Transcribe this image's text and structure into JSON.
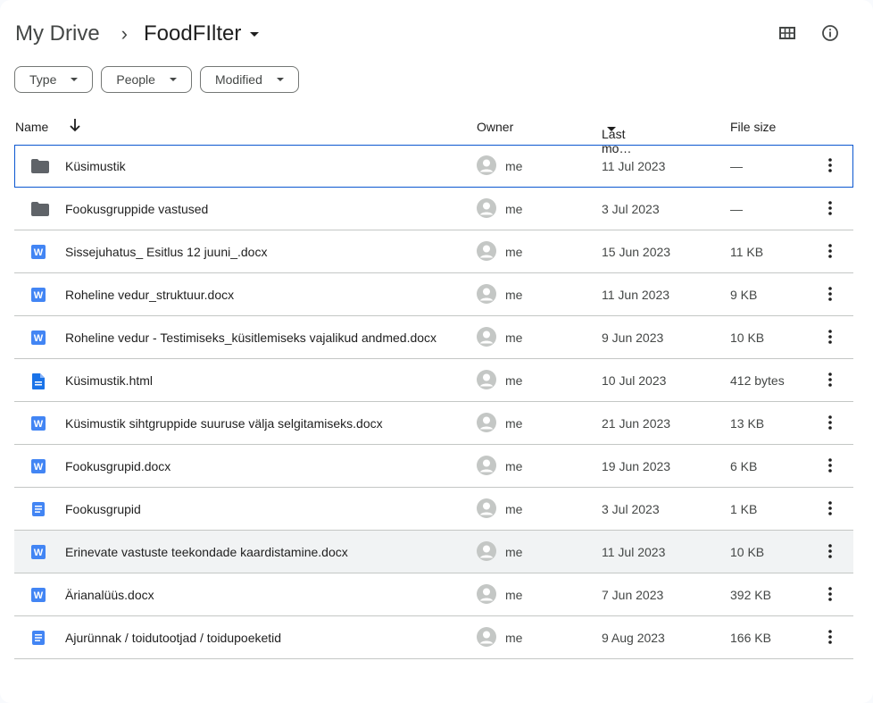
{
  "breadcrumb": {
    "root": "My Drive",
    "separator": "›",
    "current": "FoodFIlter"
  },
  "filters": [
    "Type",
    "People",
    "Modified"
  ],
  "columns": {
    "name": "Name",
    "owner": "Owner",
    "modified": "Last mo…",
    "size": "File size"
  },
  "colors": {
    "folder": "#5f6368",
    "word": "#4285f4",
    "doc": "#4285f4",
    "html": "#1a73e8",
    "selected_border": "#0b57d0"
  },
  "rows": [
    {
      "name": "Küsimustik",
      "type": "folder",
      "owner": "me",
      "date": "11 Jul 2023",
      "size": "—"
    },
    {
      "name": "Fookusgruppide vastused",
      "type": "folder",
      "owner": "me",
      "date": "3 Jul 2023",
      "size": "—"
    },
    {
      "name": "Sissejuhatus_ Esitlus 12 juuni_.docx",
      "type": "word",
      "owner": "me",
      "date": "15 Jun 2023",
      "size": "11 KB"
    },
    {
      "name": "Roheline vedur_struktuur.docx",
      "type": "word",
      "owner": "me",
      "date": "11 Jun 2023",
      "size": "9 KB"
    },
    {
      "name": "Roheline vedur - Testimiseks_küsitlemiseks vajalikud andmed.docx",
      "type": "word",
      "owner": "me",
      "date": "9 Jun 2023",
      "size": "10 KB"
    },
    {
      "name": "Küsimustik.html",
      "type": "html",
      "owner": "me",
      "date": "10 Jul 2023",
      "size": "412 bytes"
    },
    {
      "name": "Küsimustik sihtgruppide suuruse välja selgitamiseks.docx",
      "type": "word",
      "owner": "me",
      "date": "21 Jun 2023",
      "size": "13 KB"
    },
    {
      "name": "Fookusgrupid.docx",
      "type": "word",
      "owner": "me",
      "date": "19 Jun 2023",
      "size": "6 KB"
    },
    {
      "name": "Fookusgrupid",
      "type": "doc",
      "owner": "me",
      "date": "3 Jul 2023",
      "size": "1 KB"
    },
    {
      "name": "Erinevate vastuste teekondade kaardistamine.docx",
      "type": "word",
      "owner": "me",
      "date": "11 Jul 2023",
      "size": "10 KB"
    },
    {
      "name": "Ärianalüüs.docx",
      "type": "word",
      "owner": "me",
      "date": "7 Jun 2023",
      "size": "392 KB"
    },
    {
      "name": "Ajurünnak  / toidutootjad / toidupoeketid",
      "type": "doc",
      "owner": "me",
      "date": "9 Aug 2023",
      "size": "166 KB"
    }
  ],
  "selected_row": 0,
  "hover_row": 9
}
